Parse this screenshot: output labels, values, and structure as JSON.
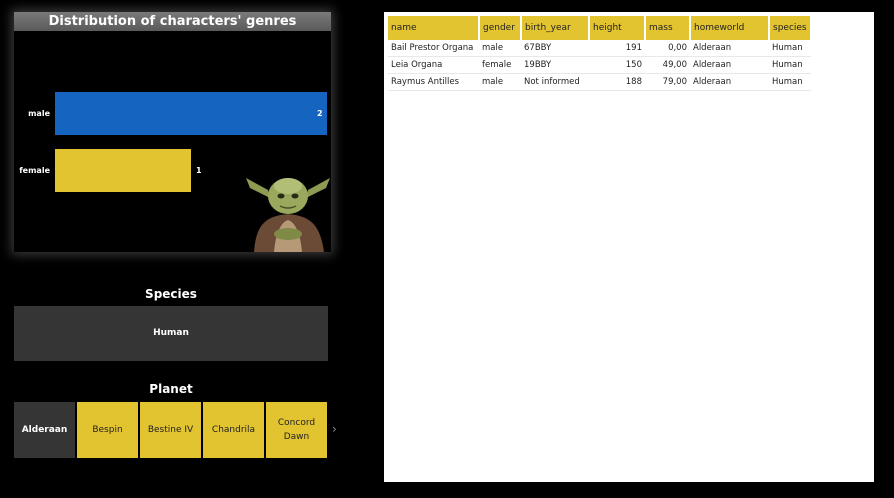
{
  "chart": {
    "title": "Distribution of characters' genres"
  },
  "chart_data": {
    "type": "bar",
    "title": "Distribution of characters' genres",
    "categories": [
      "male",
      "female"
    ],
    "values": [
      2,
      1
    ],
    "colors": [
      "#1565C0",
      "#E2C330"
    ],
    "xlim": [
      0,
      2
    ]
  },
  "species": {
    "title": "Species",
    "selected": "Human"
  },
  "planet": {
    "title": "Planet",
    "items": [
      {
        "label": "Alderaan",
        "selected": true
      },
      {
        "label": "Bespin",
        "selected": false
      },
      {
        "label": "Bestine IV",
        "selected": false
      },
      {
        "label": "Chandrila",
        "selected": false
      },
      {
        "label": "Concord Dawn",
        "selected": false
      }
    ]
  },
  "table": {
    "columns": [
      "name",
      "gender",
      "birth_year",
      "height",
      "mass",
      "homeworld",
      "species"
    ],
    "rows": [
      [
        "Bail Prestor Organa",
        "male",
        "67BBY",
        "191",
        "0,00",
        "Alderaan",
        "Human"
      ],
      [
        "Leia Organa",
        "female",
        "19BBY",
        "150",
        "49,00",
        "Alderaan",
        "Human"
      ],
      [
        "Raymus Antilles",
        "male",
        "Not informed",
        "188",
        "79,00",
        "Alderaan",
        "Human"
      ]
    ]
  },
  "colors": {
    "accent": "#E2C330",
    "male_bar": "#1565C0",
    "tile_dark": "#353535"
  }
}
